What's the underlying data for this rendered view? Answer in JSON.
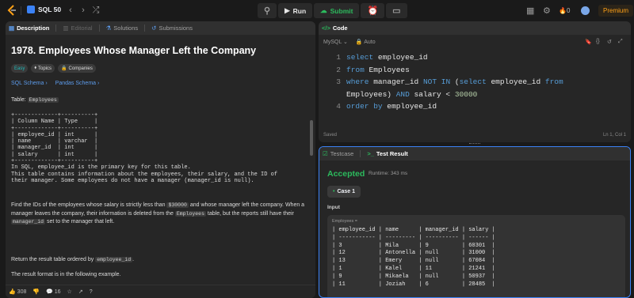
{
  "topbar": {
    "problem_list": "SQL 50",
    "run": "Run",
    "submit": "Submit",
    "streak": "0",
    "premium": "Premium"
  },
  "left": {
    "tabs": [
      "Description",
      "Editorial",
      "Solutions",
      "Submissions"
    ],
    "title": "1978. Employees Whose Manager Left the Company",
    "chips": {
      "difficulty": "Easy",
      "topics": "Topics",
      "companies": "Companies"
    },
    "schemas": [
      "SQL Schema",
      "Pandas Schema"
    ],
    "table_label": "Table:",
    "table_name": "Employees",
    "schema_block": "+-------------+----------+\n| Column Name | Type     |\n+-------------+----------+\n| employee_id | int      |\n| name        | varchar  |\n| manager_id  | int      |\n| salary      | int      |\n+-------------+----------+\nIn SQL, employee_id is the primary key for this table.\nThis table contains information about the employees, their salary, and the ID of\ntheir manager. Some employees do not have a manager (manager_id is null).",
    "para1_a": "Find the IDs of the employees whose salary is strictly less than ",
    "para1_code": "$30000",
    "para1_b": " and whose manager left the company. When a manager leaves the company, their information is deleted from the ",
    "para1_code2": "Employees",
    "para1_c": " table, but the reports still have their ",
    "para1_code3": "manager_id",
    "para1_d": " set to the manager that left.",
    "para2_a": "Return the result table ordered by ",
    "para2_code": "employee_id",
    "para2_b": ".",
    "para3": "The result format is in the following example.",
    "footer": {
      "likes": "308",
      "comments": "16"
    }
  },
  "code": {
    "tab": "Code",
    "lang": "MySQL",
    "auto": "Auto",
    "line_numbers": [
      "1",
      "2",
      "3",
      "",
      "4"
    ],
    "status": "Saved",
    "cursor": "Ln 1, Col 1"
  },
  "result": {
    "tabs": [
      "Testcase",
      "Test Result"
    ],
    "accepted": "Accepted",
    "runtime": "Runtime: 343 ms",
    "case": "Case 1",
    "input_label": "Input",
    "input_name": "Employees =",
    "table": "| employee_id | name      | manager_id | salary |\n| ----------- | --------- | ---------- | ------ |\n| 3           | Mila      | 9          | 60301  |\n| 12          | Antonella | null       | 31000  |\n| 13          | Emery     | null       | 67084  |\n| 1           | Kalel     | 11         | 21241  |\n| 9           | Mikaela   | null       | 50937  |\n| 11          | Joziah    | 6          | 28485  |"
  }
}
